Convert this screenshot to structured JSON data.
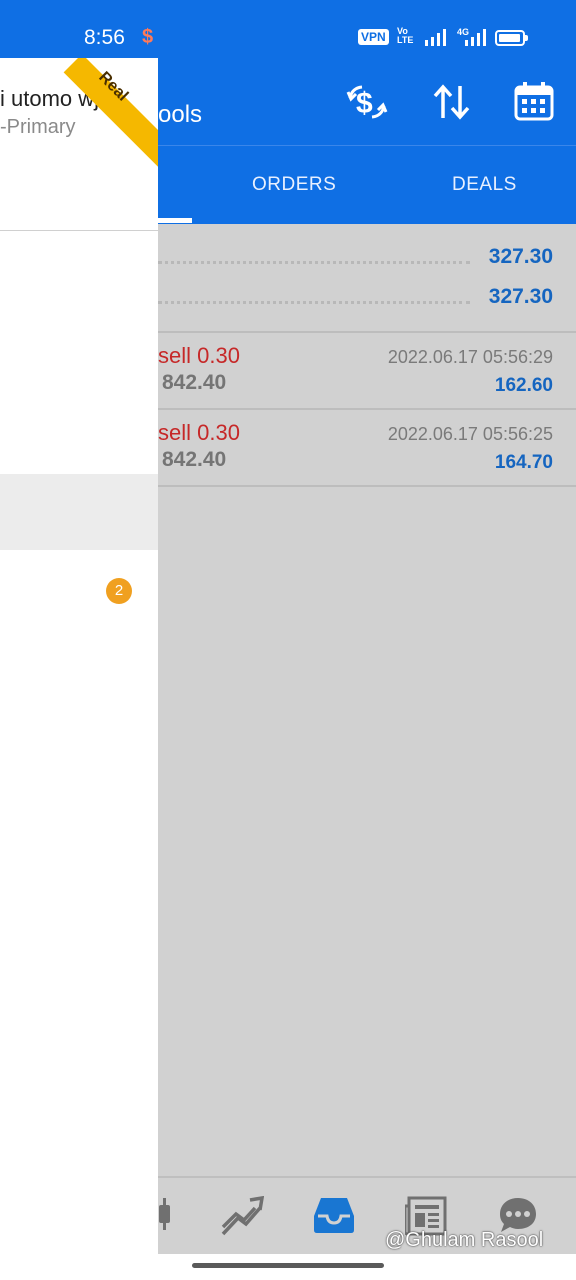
{
  "status_bar": {
    "time": "8:56",
    "notification_glyph": "$",
    "vpn": "VPN",
    "volte_top": "Vo",
    "volte_bottom": "LTE",
    "network": "4G"
  },
  "header": {
    "title_partial": "ools",
    "icons": [
      "currency-exchange-icon",
      "sort-icon",
      "calendar-icon"
    ]
  },
  "tabs": [
    {
      "label": "ORDERS"
    },
    {
      "label": "DEALS"
    }
  ],
  "summary": [
    {
      "value": "327.30"
    },
    {
      "value": "327.30"
    }
  ],
  "deals": [
    {
      "type": "sell 0.30",
      "price": "842.40",
      "time": "2022.06.17 05:56:29",
      "profit": "162.60"
    },
    {
      "type": "sell 0.30",
      "price": "842.40",
      "time": "2022.06.17 05:56:25",
      "profit": "164.70"
    }
  ],
  "drawer": {
    "account_name": "i utomo wj...",
    "account_server": "-Primary",
    "ribbon": "Real",
    "badge": "2"
  },
  "bottom_nav": [
    "candlestick-icon",
    "trend-icon",
    "inbox-icon",
    "news-icon",
    "chat-icon"
  ],
  "watermark": "@Ghulam Rasool",
  "colors": {
    "accent": "#0f6fe4",
    "sell": "#c62828",
    "value": "#1565c0",
    "badge": "#f0a020",
    "ribbon": "#f5b800"
  }
}
